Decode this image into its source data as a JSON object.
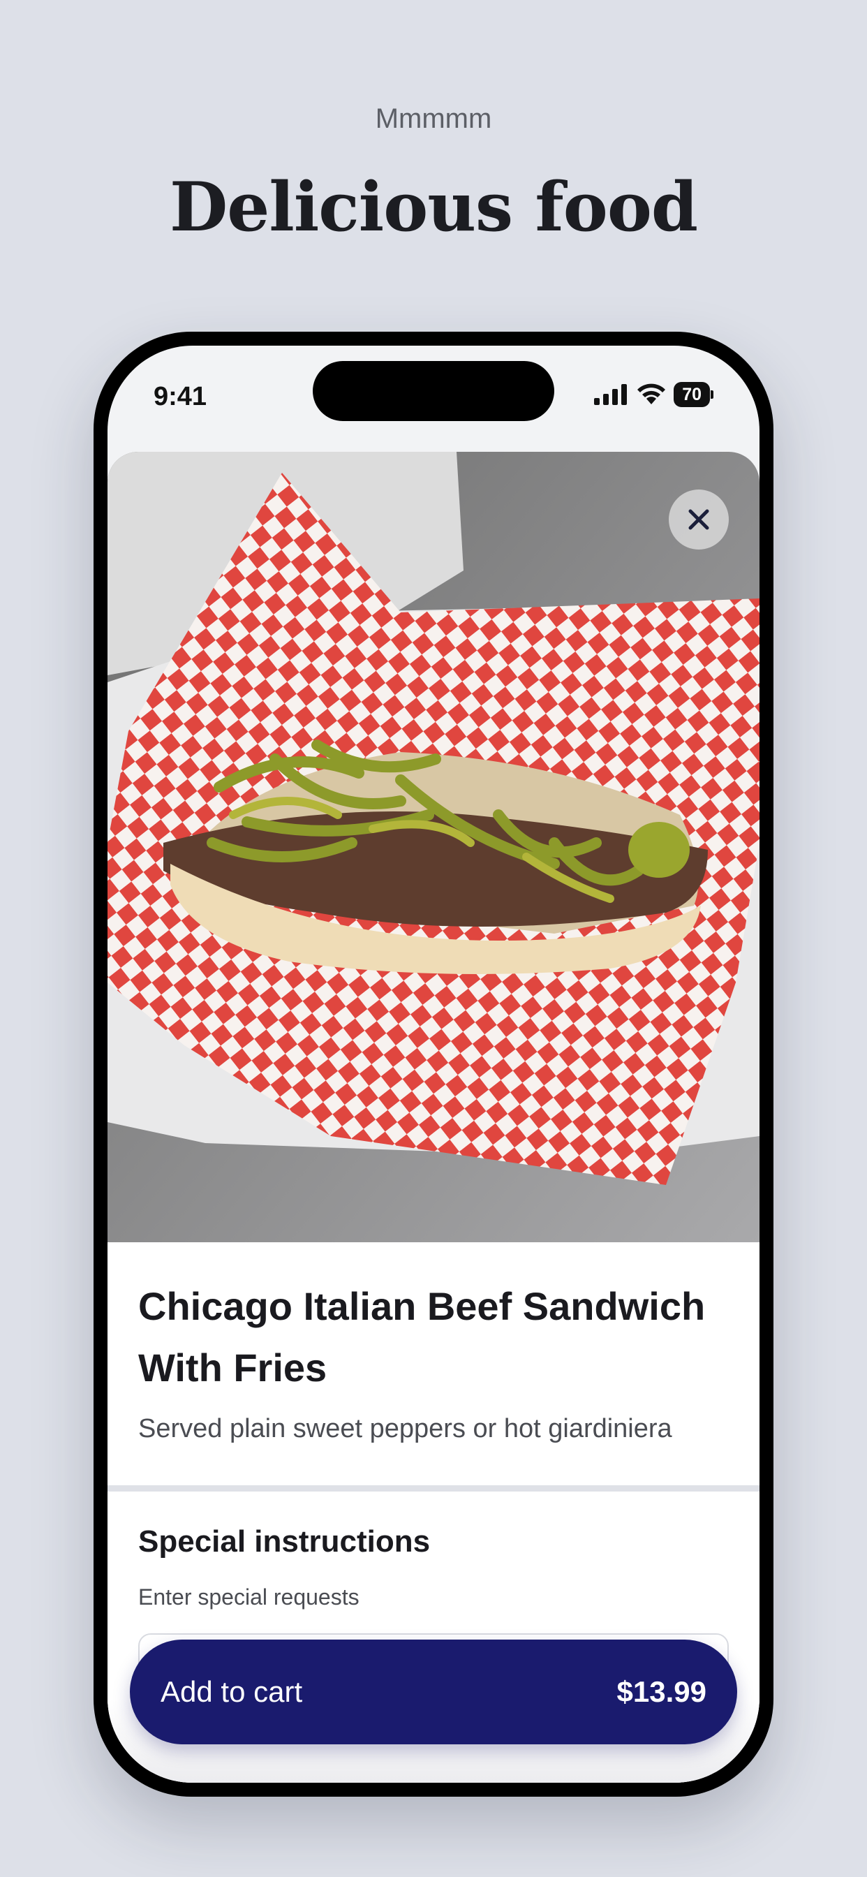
{
  "header": {
    "eyebrow": "Mmmmm",
    "headline": "Delicious food"
  },
  "status_bar": {
    "time": "9:41",
    "battery": "70",
    "icons": [
      "signal-icon",
      "wifi-icon",
      "battery-icon"
    ]
  },
  "item": {
    "image_icon": "sandwich-photo",
    "close_icon": "close-icon",
    "title": "Chicago Italian Beef Sandwich With Fries",
    "description": "Served plain sweet peppers or hot giardiniera"
  },
  "special_instructions": {
    "title": "Special instructions",
    "subtitle": "Enter special requests",
    "value": ""
  },
  "cart": {
    "label": "Add to cart",
    "price": "$13.99"
  },
  "colors": {
    "background": "#dde0e8",
    "accent": "#1a1b6e",
    "checker_red": "#e0463f"
  }
}
